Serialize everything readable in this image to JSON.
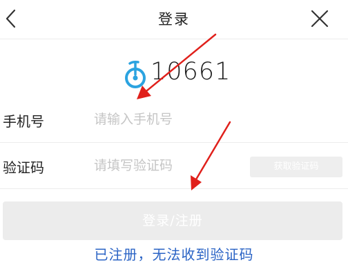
{
  "header": {
    "title": "登录",
    "back_icon": "chevron-left-icon",
    "close_icon": "close-icon"
  },
  "logo": {
    "text": "10661",
    "icon": "unicycle-logo-icon",
    "accent_color": "#2ba3e0"
  },
  "form": {
    "phone": {
      "label": "手机号",
      "placeholder": "请输入手机号",
      "value": ""
    },
    "code": {
      "label": "验证码",
      "placeholder": "请填写验证码",
      "value": "",
      "get_code_label": "获取验证码"
    },
    "submit_label": "登录/注册"
  },
  "help_link": "已注册，无法收到验证码",
  "annotation": {
    "arrow_color": "#e0201b"
  }
}
